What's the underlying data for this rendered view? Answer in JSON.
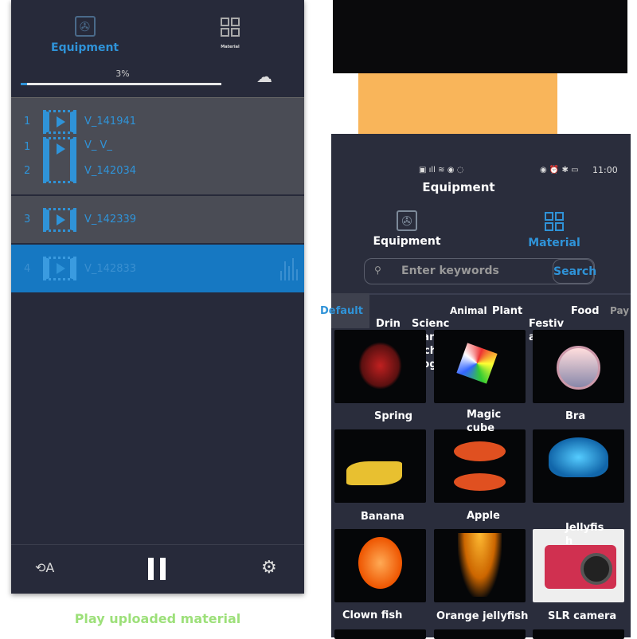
{
  "left_screen": {
    "tabs": [
      {
        "label": "Equipment",
        "icon": "fan-icon",
        "active": true
      },
      {
        "label": "Material",
        "icon": "grid-icon",
        "active": false
      }
    ],
    "progress": {
      "label": "3%",
      "value": 0.03
    },
    "upload_icon": "cloud-upload-icon",
    "items": [
      {
        "index": "1",
        "name": "V_141941"
      },
      {
        "index": "1",
        "name": "V_ V_"
      },
      {
        "index": "2",
        "name": "V_142034"
      },
      {
        "index": "3",
        "name": "V_142339"
      },
      {
        "index": "4",
        "name": "V_142833",
        "selected": true
      }
    ],
    "bottom_icons": [
      "screen-rotate-icon",
      "pause-icon",
      "settings-icon"
    ],
    "caption": "Play uploaded material"
  },
  "right_screen": {
    "status_time": "11:00",
    "title": "Equipment",
    "tabs": [
      {
        "label": "Equipment",
        "icon": "fan-icon",
        "active": false
      },
      {
        "label": "Material",
        "icon": "grid-icon",
        "active": true
      }
    ],
    "search": {
      "placeholder": "Enter keywords",
      "button": "Search"
    },
    "categories": [
      "Default",
      "Drin ks",
      "Scienc e and techn ology",
      "Animal",
      "Plant",
      "Festiv al",
      "Food",
      "Pay"
    ],
    "grid": [
      {
        "label": "Spring"
      },
      {
        "label": "Magic cube"
      },
      {
        "label": "Bra"
      },
      {
        "label": "Banana"
      },
      {
        "label": "Apple"
      },
      {
        "label": "Jellyfis h"
      },
      {
        "label": "Clown fish"
      },
      {
        "label": "Orange jellyfish"
      },
      {
        "label": "SLR camera"
      }
    ]
  },
  "colors": {
    "accent": "#2f93d8",
    "bg": "#272a3a",
    "caption": "#9de07a",
    "selected_row": "#1678c2"
  }
}
